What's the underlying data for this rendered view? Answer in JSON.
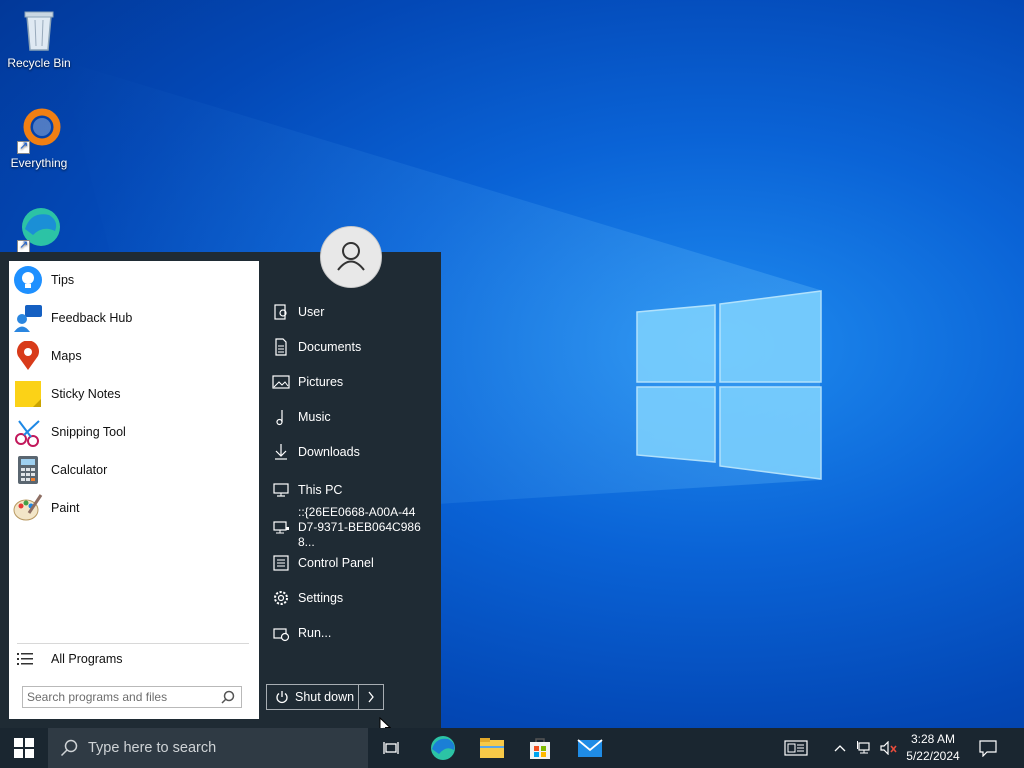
{
  "desktop": {
    "icons": [
      {
        "label": "Recycle Bin"
      },
      {
        "label": "Everything"
      },
      {
        "label": ""
      }
    ]
  },
  "start_menu": {
    "pinned_apps": [
      {
        "label": "Tips"
      },
      {
        "label": "Feedback Hub"
      },
      {
        "label": "Maps"
      },
      {
        "label": "Sticky Notes"
      },
      {
        "label": "Snipping Tool"
      },
      {
        "label": "Calculator"
      },
      {
        "label": "Paint"
      }
    ],
    "all_programs": "All Programs",
    "search_placeholder": "Search programs and files",
    "right_items": [
      {
        "label": "User"
      },
      {
        "label": "Documents"
      },
      {
        "label": "Pictures"
      },
      {
        "label": "Music"
      },
      {
        "label": "Downloads"
      },
      {
        "label": "This PC"
      },
      {
        "label": "::{26EE0668-A00A-44D7-9371-BEB064C9868..."
      },
      {
        "label": "Control Panel"
      },
      {
        "label": "Settings"
      },
      {
        "label": "Run..."
      }
    ],
    "shutdown_label": "Shut down"
  },
  "taskbar": {
    "search_placeholder": "Type here to search",
    "clock_time": "3:28 AM",
    "clock_date": "5/22/2024"
  },
  "colors": {
    "menu_bg": "#1f2b34",
    "taskbar_bg": "#1a2630",
    "accent": "#0078d7"
  }
}
